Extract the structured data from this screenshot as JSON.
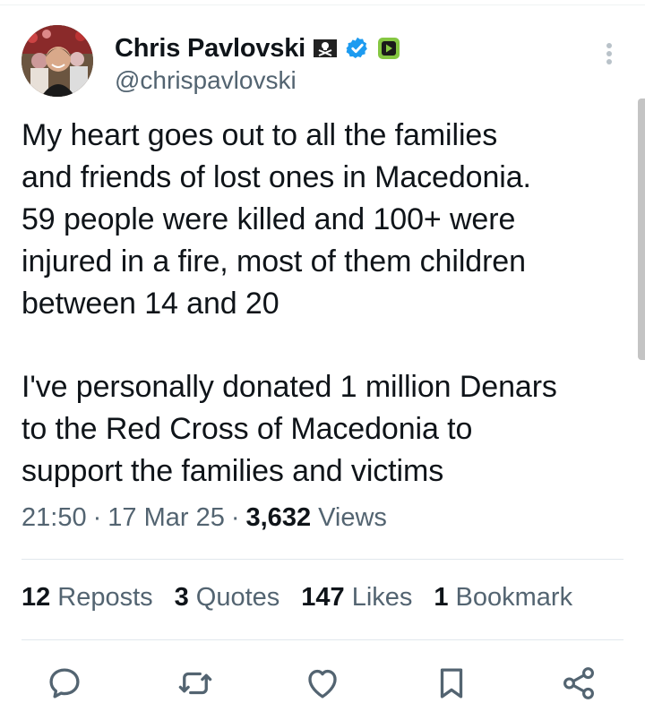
{
  "author": {
    "display_name": "Chris Pavlovski",
    "handle": "@chrispavlovski",
    "badges": [
      "pirate-flag-icon",
      "verified-icon",
      "rumble-icon"
    ]
  },
  "tweet": {
    "paragraph1": "My heart goes out to all the families\nand friends of lost ones in Macedonia.\n59 people were killed and 100+ were\ninjured in a fire, most of them children\nbetween 14 and 20",
    "paragraph2": "I've personally donated 1 million Denars\nto the Red Cross of Macedonia to\nsupport the families and victims"
  },
  "meta": {
    "time": "21:50",
    "date": "17 Mar 25",
    "views_count": "3,632",
    "views_label": "Views"
  },
  "stats": {
    "reposts_count": "12",
    "reposts_label": "Reposts",
    "quotes_count": "3",
    "quotes_label": "Quotes",
    "likes_count": "147",
    "likes_label": "Likes",
    "bookmarks_count": "1",
    "bookmarks_label": "Bookmark"
  },
  "actions": [
    "reply-icon",
    "repost-icon",
    "like-icon",
    "bookmark-icon",
    "share-icon"
  ],
  "colors": {
    "text": "#0f1419",
    "secondary": "#536471",
    "verified": "#1d9bf0",
    "rumble": "#85c742"
  }
}
